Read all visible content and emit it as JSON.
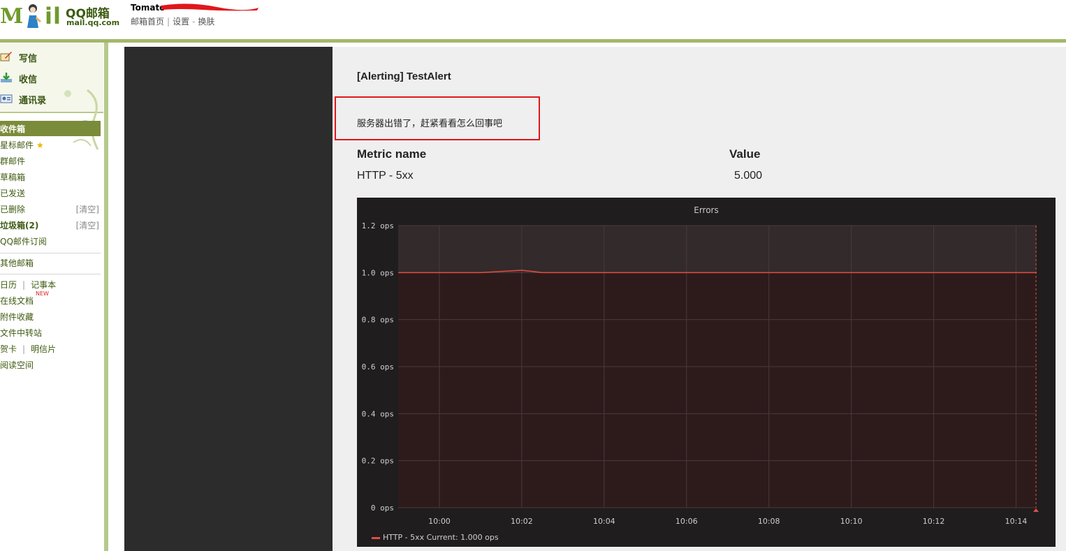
{
  "header": {
    "logo_text": "Mail",
    "logo_cn": "QQ邮箱",
    "logo_domain": "mail.qq.com",
    "user_name": "Tomato",
    "links": [
      "邮箱首页",
      "设置",
      "换肤"
    ]
  },
  "sidebar": {
    "quick": [
      {
        "label": "写信",
        "icon": "compose-icon"
      },
      {
        "label": "收信",
        "icon": "download-icon"
      },
      {
        "label": "通讯录",
        "icon": "contacts-icon"
      }
    ],
    "inbox": "收件箱",
    "folders": [
      {
        "label": "星标邮件"
      },
      {
        "label": "群邮件"
      },
      {
        "label": "草稿箱"
      },
      {
        "label": "已发送"
      },
      {
        "label": "已删除",
        "clear": "[清空]"
      },
      {
        "label": "垃圾箱(2)",
        "clear": "[清空]"
      },
      {
        "label": "QQ邮件订阅"
      }
    ],
    "other": "其他邮箱",
    "tools": {
      "calendar": "日历",
      "notepad": "记事本",
      "docs": "在线文档",
      "new_badge": "NEW",
      "attachments": "附件收藏",
      "transfer": "文件中转站",
      "card": "贺卡",
      "postcard": "明信片",
      "reading": "阅读空间"
    }
  },
  "mail": {
    "title": "[Alerting] TestAlert",
    "message": "服务器出错了，赶紧看看怎么回事吧",
    "metric_header": "Metric name",
    "value_header": "Value",
    "metric_name": "HTTP - 5xx",
    "metric_value": "5.000"
  },
  "chart_data": {
    "type": "line",
    "title": "Errors",
    "x": [
      "09:59",
      "10:00",
      "10:01",
      "10:02",
      "10:02:30",
      "10:03",
      "10:04",
      "10:05",
      "10:06",
      "10:07",
      "10:08",
      "10:09",
      "10:10",
      "10:11",
      "10:12",
      "10:13",
      "10:14",
      "10:14:30"
    ],
    "x_ticks": [
      "10:00",
      "10:02",
      "10:04",
      "10:06",
      "10:08",
      "10:10",
      "10:12",
      "10:14"
    ],
    "y_ticks": [
      "0 ops",
      "0.2 ops",
      "0.4 ops",
      "0.6 ops",
      "0.8 ops",
      "1.0 ops",
      "1.2 ops"
    ],
    "ylim": [
      0,
      1.2
    ],
    "threshold": 1.0,
    "series": [
      {
        "name": "HTTP - 5xx",
        "values": [
          1,
          1,
          1,
          1.01,
          1,
          1,
          1,
          1,
          1,
          1,
          1,
          1,
          1,
          1,
          1,
          1,
          1,
          1
        ]
      }
    ],
    "legend": "HTTP - 5xx  Current: 1.000 ops",
    "colors": {
      "series": "#e24d42",
      "background": "#1f1d1d",
      "plot": "#2d1b1c"
    }
  }
}
